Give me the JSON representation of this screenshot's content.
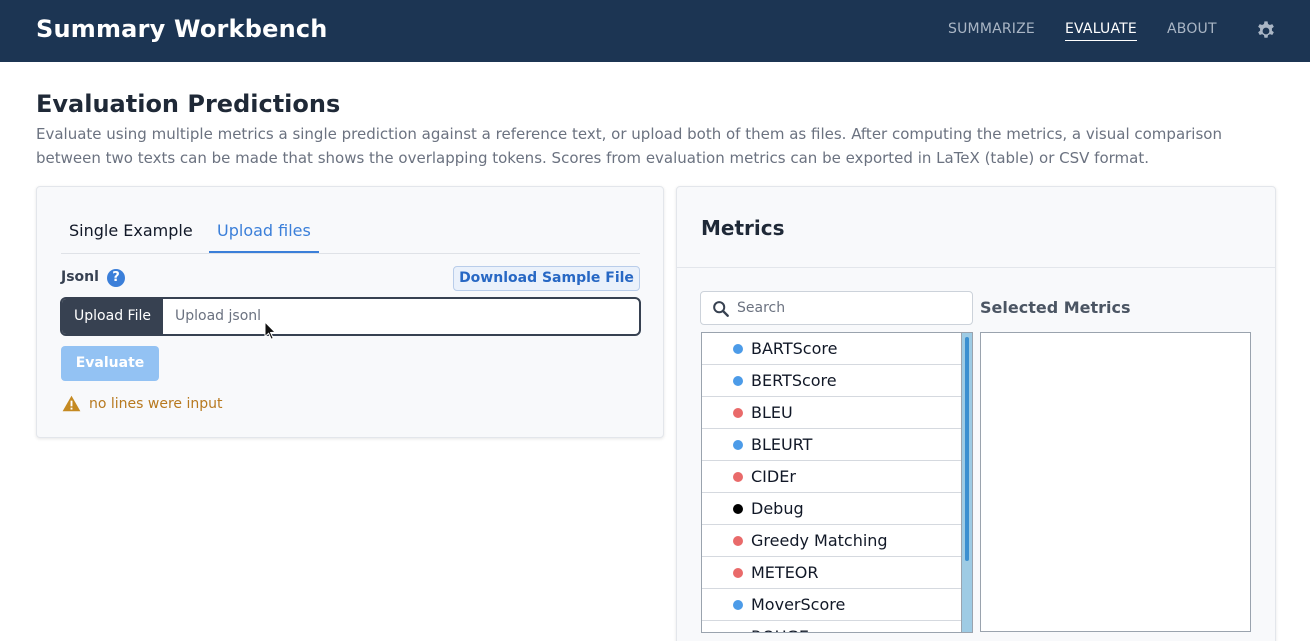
{
  "header": {
    "title": "Summary Workbench",
    "nav": [
      "SUMMARIZE",
      "EVALUATE",
      "ABOUT"
    ],
    "active_nav": "EVALUATE",
    "settings_icon": "gear-icon"
  },
  "page": {
    "title": "Evaluation Predictions",
    "description": "Evaluate using multiple metrics a single prediction against a reference text, or upload both of them as files. After computing the metrics, a visual comparison between two texts can be made that shows the overlapping tokens. Scores from evaluation metrics can be exported in LaTeX (table) or CSV format."
  },
  "input_card": {
    "tabs": [
      "Single Example",
      "Upload files"
    ],
    "active_tab": "Upload files",
    "format_label": "Jsonl",
    "help_icon": "question-circle-icon",
    "download_label": "Download Sample File",
    "upload_button": "Upload File",
    "upload_placeholder": "Upload jsonl",
    "evaluate_label": "Evaluate",
    "warning_icon": "warning-triangle-icon",
    "warning": "no lines were input"
  },
  "metrics_card": {
    "title": "Metrics",
    "search_placeholder": "Search",
    "search_icon": "search-icon",
    "selected_title": "Selected Metrics",
    "items": [
      {
        "name": "BARTScore",
        "color": "#4c9be8"
      },
      {
        "name": "BERTScore",
        "color": "#4c9be8"
      },
      {
        "name": "BLEU",
        "color": "#e96a6a"
      },
      {
        "name": "BLEURT",
        "color": "#4c9be8"
      },
      {
        "name": "CIDEr",
        "color": "#e96a6a"
      },
      {
        "name": "Debug",
        "color": "#000000"
      },
      {
        "name": "Greedy Matching",
        "color": "#e96a6a"
      },
      {
        "name": "METEOR",
        "color": "#e96a6a"
      },
      {
        "name": "MoverScore",
        "color": "#4c9be8"
      },
      {
        "name": "ROUGE",
        "color": "#e96a6a"
      }
    ]
  },
  "colors": {
    "header_bg": "#1c3553",
    "accent": "#3b7fd9",
    "warning": "#b7791f",
    "evaluate_disabled": "#93c2f3"
  }
}
